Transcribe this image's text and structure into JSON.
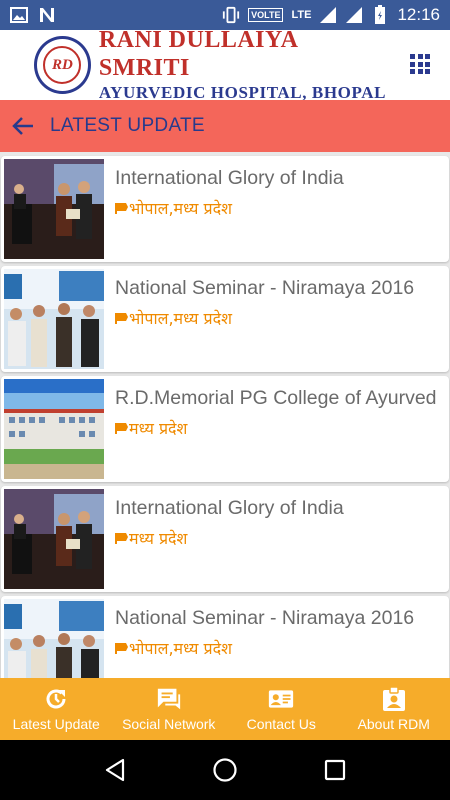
{
  "status_bar": {
    "time": "12:16",
    "volte": "VOLTE",
    "network": "LTE",
    "icons_left": [
      "image-icon",
      "n-icon"
    ],
    "icons_right": [
      "vibrate-icon",
      "signal-icon",
      "signal-icon",
      "battery-icon"
    ]
  },
  "header": {
    "logo_seal": "RD",
    "logo_line1": "RANI DULLAIYA SMRITI",
    "logo_line2": "AYURVEDIC HOSPITAL, BHOPAL",
    "menu_icon": "grid-menu-icon"
  },
  "titlebar": {
    "title": "LATEST UPDATE",
    "back_icon": "back-arrow-icon"
  },
  "list": [
    {
      "title": "International Glory of India",
      "location": "भोपाल,मध्य प्रदेश",
      "thumb": "award-photo"
    },
    {
      "title": "National Seminar - Niramaya 2016",
      "location": "भोपाल,मध्य प्रदेश",
      "thumb": "fair-photo"
    },
    {
      "title": "R.D.Memorial PG College of Ayurved",
      "location": "मध्य प्रदेश",
      "thumb": "college-photo"
    },
    {
      "title": "International Glory of India",
      "location": "मध्य प्रदेश",
      "thumb": "award-photo"
    },
    {
      "title": "National Seminar - Niramaya 2016",
      "location": "भोपाल,मध्य प्रदेश",
      "thumb": "fair-photo"
    }
  ],
  "bottom_nav": [
    {
      "label": "Latest Update",
      "icon": "update-icon"
    },
    {
      "label": "Social Network",
      "icon": "chat-icon"
    },
    {
      "label": "Contact Us",
      "icon": "contact-card-icon"
    },
    {
      "label": "About RDM",
      "icon": "badge-icon"
    }
  ],
  "colors": {
    "status_bar": "#3a5a98",
    "title_bar": "#f4665a",
    "title_text": "#273a8c",
    "accent_orange": "#f6ac2a",
    "location_text": "#ef8a00"
  }
}
